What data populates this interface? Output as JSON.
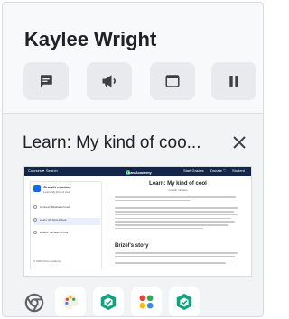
{
  "user": {
    "name": "Kaylee Wright"
  },
  "controls": [
    {
      "icon": "message-icon"
    },
    {
      "icon": "megaphone-icon"
    },
    {
      "icon": "window-icon"
    },
    {
      "icon": "pause-icon"
    }
  ],
  "app_window": {
    "title": "Learn: My kind of coo...",
    "close_icon": "close-icon"
  },
  "thumbnail": {
    "site_logo": "Khan Academy",
    "nav_left": [
      "Courses ▾",
      "Search"
    ],
    "nav_right": [
      "Start Grades",
      "Donate ♡",
      "Student"
    ],
    "sidebar": {
      "unit_title": "Growth mindset",
      "unit_subtitle": "Learn: My kind of cool",
      "items": [
        "Connect: Mindset of cool",
        "Learn: My kind of cool",
        "Reflect: Mindset of cool"
      ],
      "footer": "© 2023 Khan Academy"
    },
    "article": {
      "title": "Learn: My kind of cool",
      "subtitle": "Growth mindset",
      "section_heading": "Brizel's story"
    }
  },
  "shelf": {
    "apps": [
      "chrome-icon",
      "paint-app-icon",
      "classroom-box-icon",
      "dots-app-icon",
      "classroom-box-icon"
    ]
  },
  "colors": {
    "khan_navy": "#14254a",
    "khan_blue": "#1865f2",
    "app_green": "#10a37f",
    "panel_bg": "#f1f3f4"
  }
}
